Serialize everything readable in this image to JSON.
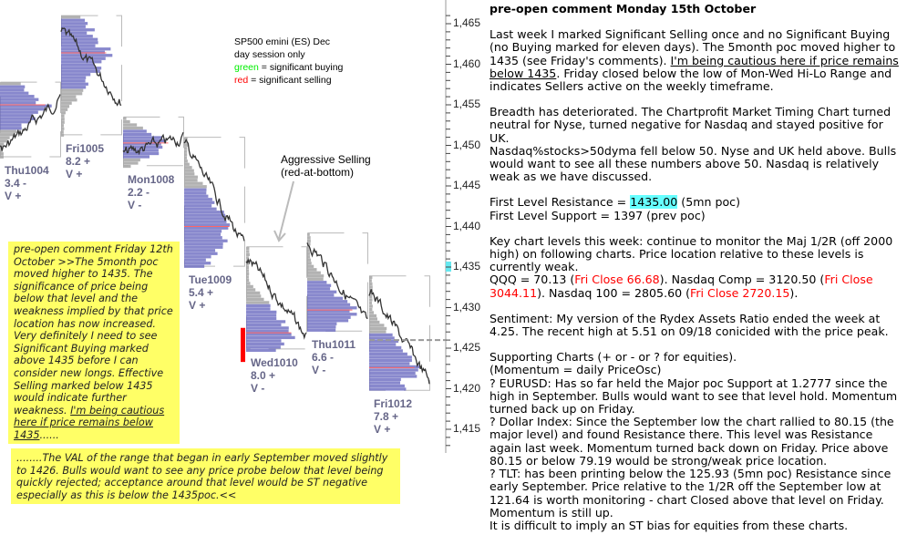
{
  "chart_data": {
    "type": "market-profile",
    "instrument_label": [
      "SP500 emini (ES) Dec",
      "day session only"
    ],
    "legend": [
      {
        "word": "green",
        "rest": " = significant buying",
        "color": "#00ee00"
      },
      {
        "word": "red",
        "rest": " = significant selling",
        "color": "#ff0000"
      }
    ],
    "y_ticks": [
      "1,465",
      "1,460",
      "1,455",
      "1,450",
      "1,445",
      "1,440",
      "1,435",
      "1,430",
      "1,425",
      "1,420",
      "1,415"
    ],
    "ylim": [
      1413,
      1466.5
    ],
    "highlighted_level": 1435,
    "dashed_level": 1426,
    "annotation": [
      "Aggressive Selling",
      "(red-at-bottom)"
    ],
    "days": [
      {
        "label": "Thu1004",
        "stat": "3.4 -",
        "vol": "V +",
        "high": 1457.8,
        "low": 1448.6,
        "poc": 1455,
        "open": 1449.5,
        "close": 1456
      },
      {
        "label": "Fri1005",
        "stat": "8.2 +",
        "vol": "V +",
        "high": 1466,
        "low": 1451.3,
        "poc": 1461.4,
        "open": 1464,
        "close": 1455
      },
      {
        "label": "Mon1008",
        "stat": "2.2 -",
        "vol": "V -",
        "high": 1453.5,
        "low": 1447.5,
        "poc": 1450.3,
        "open": 1449,
        "close": 1451
      },
      {
        "label": "Tue1009",
        "stat": "5.4 +",
        "vol": "V +",
        "high": 1451,
        "low": 1435.1,
        "poc": 1440,
        "open": 1450,
        "close": 1437
      },
      {
        "label": "Wed1010",
        "stat": "8.0 +",
        "vol": "V -",
        "high": 1437.5,
        "low": 1424.9,
        "poc": 1426.9,
        "open": 1436,
        "close": 1426
      },
      {
        "label": "Thu1011",
        "stat": "6.6 -",
        "vol": "V -",
        "high": 1439.2,
        "low": 1427.1,
        "poc": 1429.7,
        "open": 1438,
        "close": 1427.5
      },
      {
        "label": "Fri1012",
        "stat": "7.8 +",
        "vol": "V +",
        "high": 1433.9,
        "low": 1419.8,
        "poc": 1422.6,
        "open": 1432,
        "close": 1420.5
      }
    ],
    "significant_selling_marker_day": "Wed1010"
  },
  "note_friday": {
    "text": "pre-open comment Friday 12th October >>The 5month poc moved higher to 1435.  The significance of price being below that level and the weakness implied by that price location has now increased. Very definitely I need to see Significant Buying marked above 1435 before I can consider new longs. Effective Selling marked below 1435 would indicate further weakness.  ",
    "underlined": "I'm being cautious here if price remains below 1435",
    "tail": "......"
  },
  "note_val": "........The VAL of the range that began in early September moved slightly to 1426. Bulls would want to see any price probe below that level being quickly rejected; acceptance around that level would be ST negative especially as this is below the 1435poc.<<",
  "commentary": {
    "title": "pre-open comment Monday 15th October",
    "p1a": "Last week I marked Significant Selling once and no Significant Buying (no Buying marked for eleven days).  The 5month poc moved higher to 1435 (see Friday's comments).  ",
    "p1u": "I'm being cautious here if price remains below 1435",
    "p1b": ".  Friday closed below the low of Mon-Wed Hi-Lo Range and indicates Sellers active on the weekly timeframe.",
    "p2": "Breadth has deteriorated.  The Chartprofit Market Timing Chart turned neutral for Nyse, turned negative for Nasdaq and stayed positive for UK.",
    "p3": "Nasdaq%stocks>50dyma fell below 50.  Nyse and UK held above. Bulls would want to see all these numbers above 50.  Nasdaq is relatively weak as we have discussed.",
    "res_label": "First Level Resistance = ",
    "res_value": "1435.00",
    "res_note": " (5mn poc)",
    "support": "First Level Support = 1397 (prev poc)",
    "p4": "Key chart levels this week: continue to monitor the Maj 1/2R (off 2000 high) on following charts.  Price location relative to these levels is currently weak.",
    "qqq": "QQQ = 70.13 (",
    "qqq_close": "Fri Close 66.68",
    "comp": ").  Nasdaq Comp = 3120.50 (",
    "comp_close": "Fri Close 3044.11",
    "ndx": ").  Nasdaq 100 = 2805.60 (",
    "ndx_close": "Fri Close 2720.15",
    "end": ").",
    "p5": "Sentiment: My version of the Rydex Assets Ratio ended the week at 4.25.  The recent high at 5.51 on 09/18 conicided with the price peak.",
    "p6": [
      "Supporting Charts (+ or - or ? for equities).",
      "(Momentum = daily PriceOsc)",
      "? EURUSD: Has so far held the Major poc Support at 1.2777 since the high in September. Bulls would want to see that level hold.  Momentum turned back up on Friday.",
      "? Dollar Index: Since the September low the chart rallied to 80.15 (the major level) and found Resistance there. This level was Resistance again last week. Momentum turned back down on Friday. Price above 80.15 or below 79.19 would be strong/weak price location.",
      "? TLT:  has been printing below the 125.93 (5mn poc) Resistance since early September.  Price relative to the 1/2R off the September low at 121.64 is worth monitoring - chart Closed above that level on Friday. Momentum is still up.",
      "It is difficult to imply an ST bias for equities from these charts."
    ]
  }
}
